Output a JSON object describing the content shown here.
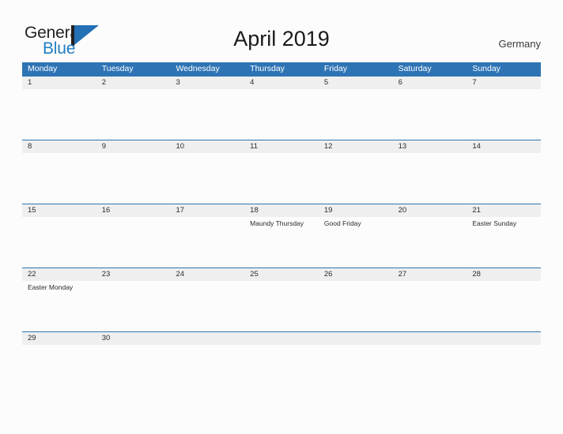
{
  "brand": {
    "name_part1": "General",
    "name_part2": "Blue",
    "mark": "sail-triangle"
  },
  "header": {
    "title": "April 2019",
    "country": "Germany"
  },
  "colors": {
    "header_blue": "#2e74b5",
    "logo_blue": "#1f7ec4",
    "daynum_band": "#efefef",
    "page_background": "#fcfcfc",
    "text": "#2b2b2b"
  },
  "calendar": {
    "weekdays": [
      "Monday",
      "Tuesday",
      "Wednesday",
      "Thursday",
      "Friday",
      "Saturday",
      "Sunday"
    ],
    "weeks": [
      {
        "days": [
          {
            "date": "1",
            "event": ""
          },
          {
            "date": "2",
            "event": ""
          },
          {
            "date": "3",
            "event": ""
          },
          {
            "date": "4",
            "event": ""
          },
          {
            "date": "5",
            "event": ""
          },
          {
            "date": "6",
            "event": ""
          },
          {
            "date": "7",
            "event": ""
          }
        ]
      },
      {
        "days": [
          {
            "date": "8",
            "event": ""
          },
          {
            "date": "9",
            "event": ""
          },
          {
            "date": "10",
            "event": ""
          },
          {
            "date": "11",
            "event": ""
          },
          {
            "date": "12",
            "event": ""
          },
          {
            "date": "13",
            "event": ""
          },
          {
            "date": "14",
            "event": ""
          }
        ]
      },
      {
        "days": [
          {
            "date": "15",
            "event": ""
          },
          {
            "date": "16",
            "event": ""
          },
          {
            "date": "17",
            "event": ""
          },
          {
            "date": "18",
            "event": "Maundy Thursday"
          },
          {
            "date": "19",
            "event": "Good Friday"
          },
          {
            "date": "20",
            "event": ""
          },
          {
            "date": "21",
            "event": "Easter Sunday"
          }
        ]
      },
      {
        "days": [
          {
            "date": "22",
            "event": "Easter Monday"
          },
          {
            "date": "23",
            "event": ""
          },
          {
            "date": "24",
            "event": ""
          },
          {
            "date": "25",
            "event": ""
          },
          {
            "date": "26",
            "event": ""
          },
          {
            "date": "27",
            "event": ""
          },
          {
            "date": "28",
            "event": ""
          }
        ]
      },
      {
        "days": [
          {
            "date": "29",
            "event": ""
          },
          {
            "date": "30",
            "event": ""
          },
          {
            "date": "",
            "event": ""
          },
          {
            "date": "",
            "event": ""
          },
          {
            "date": "",
            "event": ""
          },
          {
            "date": "",
            "event": ""
          },
          {
            "date": "",
            "event": ""
          }
        ]
      }
    ]
  }
}
